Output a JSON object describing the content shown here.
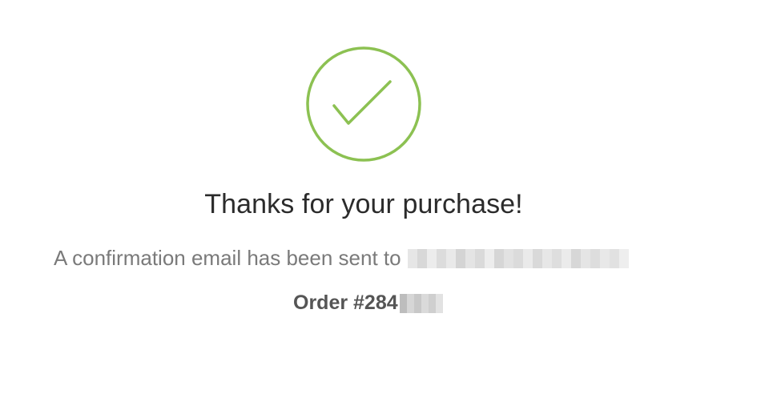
{
  "confirmation": {
    "title": "Thanks for your purchase!",
    "email_message": "A confirmation email has been sent to",
    "order_label": "Order #284"
  },
  "icons": {
    "success": "checkmark-circle-icon"
  },
  "colors": {
    "success_green": "#8cc152",
    "title_text": "#2b2b2b",
    "body_text": "#7a7a7a",
    "order_text": "#555555"
  }
}
